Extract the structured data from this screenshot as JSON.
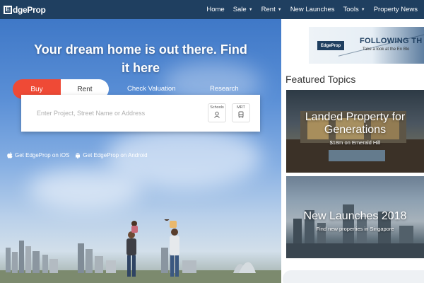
{
  "nav": {
    "logo_letter": "E",
    "logo_text": "dgeProp",
    "items": [
      {
        "label": "Home",
        "dropdown": false
      },
      {
        "label": "Sale",
        "dropdown": true
      },
      {
        "label": "Rent",
        "dropdown": true
      },
      {
        "label": "New Launches",
        "dropdown": false
      },
      {
        "label": "Tools",
        "dropdown": true
      },
      {
        "label": "Property News",
        "dropdown": false
      }
    ]
  },
  "hero": {
    "headline_line1": "Your dream home is out there. Find",
    "headline_line2_prefix": "it ",
    "headline_line2_bold": "here",
    "tabs": [
      "Buy",
      "Rent",
      "Check Valuation",
      "Research"
    ],
    "search_placeholder": "Enter Project, Street Name or Address",
    "shortcut_schools": "Schools",
    "shortcut_mrt": "MRT",
    "app_ios": "Get EdgeProp on iOS",
    "app_android": "Get EdgeProp on Android"
  },
  "ad": {
    "logo_text": "EdgeProp",
    "title": "FOLLOWING TH",
    "subtitle": "Take a look at the En Blo"
  },
  "featured": {
    "title": "Featured Topics",
    "cards": [
      {
        "title": "Landed Property for Generations",
        "subtitle": "$18m on Emerald Hill"
      },
      {
        "title": "New Launches 2018",
        "subtitle": "Find new properties in Singapore"
      }
    ]
  },
  "colors": {
    "nav_bg": "#1f3f60",
    "accent": "#ef4a36"
  }
}
